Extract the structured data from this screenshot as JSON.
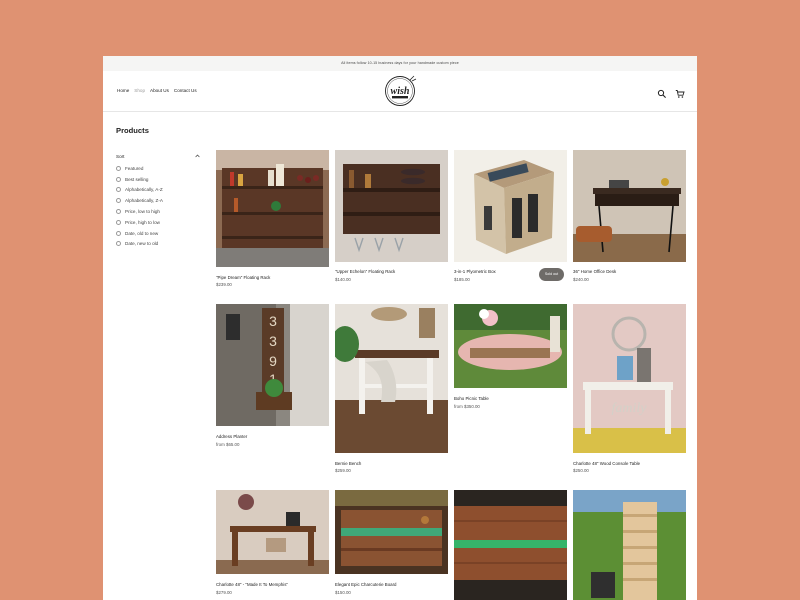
{
  "announcement": "All items follow 10-15 business days for your handmade custom piece",
  "nav": {
    "items": [
      {
        "label": "Home",
        "active": false
      },
      {
        "label": "Shop",
        "active": true
      },
      {
        "label": "About Us",
        "active": false
      },
      {
        "label": "Contact Us",
        "active": false
      }
    ]
  },
  "logo": {
    "text": "wish"
  },
  "header_icons": [
    "search-icon",
    "cart-icon"
  ],
  "page_title": "Products",
  "sort": {
    "label": "Sort",
    "options": [
      "Featured",
      "Best selling",
      "Alphabetically, A-Z",
      "Alphabetically, Z-A",
      "Price, low to high",
      "Price, high to low",
      "Date, old to new",
      "Date, new to old"
    ]
  },
  "products": [
    {
      "name": "\"Pipe Dream\" Floating Rack",
      "price": "$239.00"
    },
    {
      "name": "\"Upper Echelon\" Floating Rack",
      "price": "$140.00"
    },
    {
      "name": "3-in-1 Plyometric Box",
      "price": "$185.00",
      "badge": "Sold out"
    },
    {
      "name": "36\" Home Office Desk",
      "price": "$240.00"
    },
    {
      "name": "Address Planter",
      "price": "from $65.00"
    },
    {
      "name": "Bernie Bench",
      "price": "$259.00"
    },
    {
      "name": "Boho Picnic Table",
      "price": "from $350.00"
    },
    {
      "name": "Charlotte 48\" Wood Console Table",
      "price": "$250.00"
    },
    {
      "name": "Charlotte 48\" - \"Made It To Memphis\"",
      "price": "$279.00"
    },
    {
      "name": "Elegant Epic Charcuterie Board",
      "price": "$150.00"
    },
    {
      "name": "",
      "price": ""
    },
    {
      "name": "",
      "price": ""
    }
  ],
  "colors": {
    "backdrop": "#DF9272",
    "announcement_bar": "#F5F5F4",
    "sold_badge": "#6E6B68"
  }
}
